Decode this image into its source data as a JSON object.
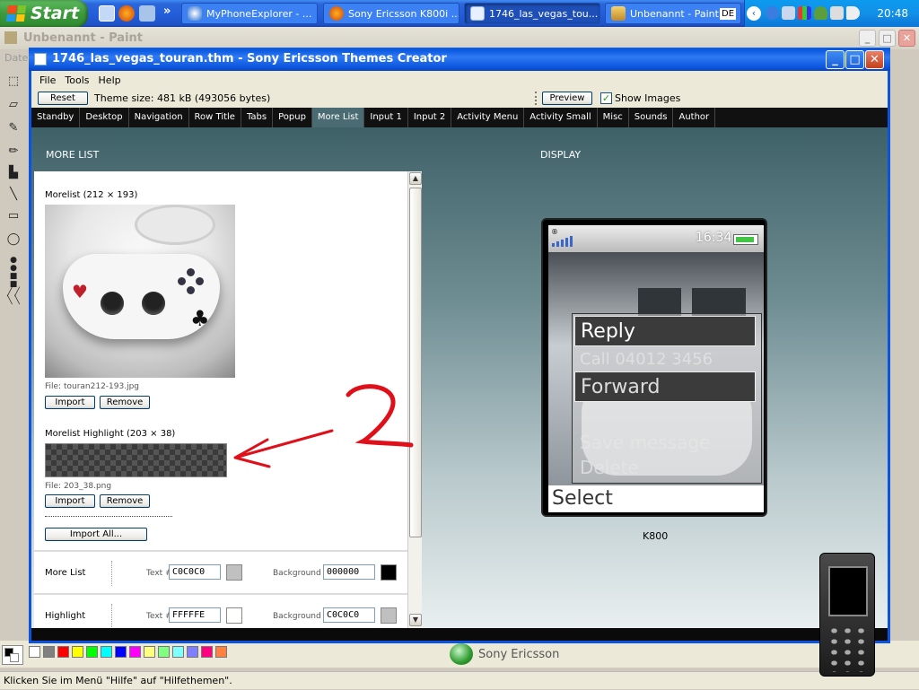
{
  "taskbar": {
    "start_label": "Start",
    "tasks": [
      {
        "label": "MyPhoneExplorer - ..."
      },
      {
        "label": "Sony Ericsson K800i ..."
      },
      {
        "label": "1746_las_vegas_tou..."
      },
      {
        "label": "Unbenannt - Paint"
      }
    ],
    "language": "DE",
    "clock": "20:48"
  },
  "paint": {
    "title": "Unbenannt - Paint",
    "menu_partial": "Date",
    "status_text": "Klicken Sie im Menü \"Hilfe\" auf \"Hilfethemen\"."
  },
  "colors": {
    "palette": [
      "#000000",
      "#ffffff",
      "#808080",
      "#c0c0c0",
      "#ff0000",
      "#ffff00",
      "#00ff00",
      "#00ffff",
      "#0000ff",
      "#ff00ff",
      "#ffff80",
      "#80ff80",
      "#80ffff",
      "#8080ff",
      "#ff0080",
      "#ff8040"
    ],
    "annotation_red": "#e0101a"
  },
  "themes_creator": {
    "title": "1746_las_vegas_touran.thm - Sony Ericsson Themes Creator",
    "menu": [
      "File",
      "Tools",
      "Help"
    ],
    "reset_label": "Reset",
    "theme_size": "Theme size: 481 kB (493056 bytes)",
    "preview_label": "Preview",
    "show_images_label": "Show Images",
    "tabs": [
      "Standby",
      "Desktop",
      "Navigation",
      "Row Title",
      "Tabs",
      "Popup",
      "More List",
      "Input 1",
      "Input 2",
      "Activity Menu",
      "Activity Small",
      "Misc",
      "Sounds",
      "Author"
    ],
    "active_tab": "More List",
    "section_title": "MORE LIST",
    "display_title": "DISPLAY",
    "morelist_label": "Morelist (212 × 193)",
    "morelist_file": "File: touran212-193.jpg",
    "import_label": "Import",
    "remove_label": "Remove",
    "highlight_label": "Morelist Highlight (203 × 38)",
    "highlight_file": "File: 203_38.png",
    "import_all_label": "Import All...",
    "rows": [
      {
        "name": "More List",
        "text_label": "Text #",
        "text_value": "C0C0C0",
        "text_color": "#c0c0c0",
        "bg_label": "Background #",
        "bg_value": "000000",
        "bg_color": "#000000"
      },
      {
        "name": "Highlight",
        "text_label": "Text #",
        "text_value": "FFFFFE",
        "text_color": "#fffffe",
        "bg_label": "Background #",
        "bg_value": "C0C0C0",
        "bg_color": "#c0c0c0"
      }
    ],
    "phone": {
      "time": "16:34",
      "menu_items": [
        "Reply",
        "Call 04012 3456",
        "Forward",
        "Save message",
        "Delete"
      ],
      "softkey": "Select",
      "model": "K800"
    },
    "brand": "Sony Ericsson"
  },
  "annotation": {
    "number": "2"
  }
}
